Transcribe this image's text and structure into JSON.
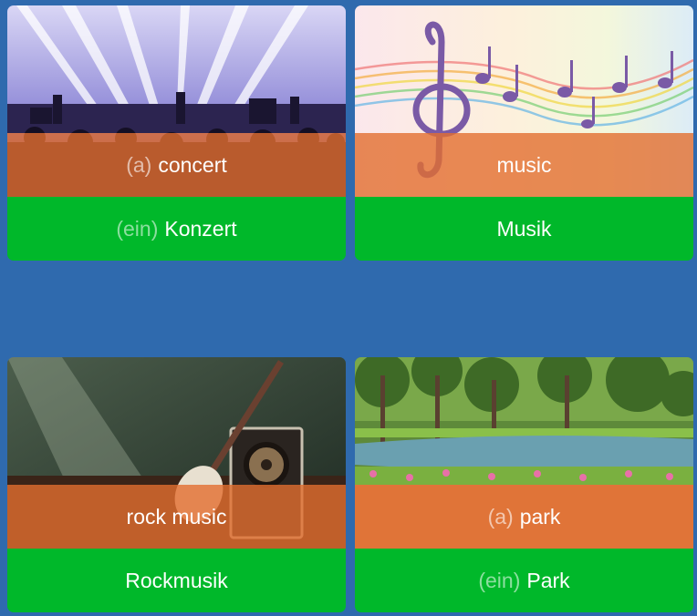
{
  "cards": [
    {
      "image": "concert-stage-photo",
      "english_article": "(a)",
      "english": "concert",
      "german_article": "(ein)",
      "german": "Konzert"
    },
    {
      "image": "music-notes-rainbow-photo",
      "english_article": "",
      "english": "music",
      "german_article": "",
      "german": "Musik"
    },
    {
      "image": "electric-guitar-amp-photo",
      "english_article": "",
      "english": "rock music",
      "german_article": "",
      "german": "Rockmusik"
    },
    {
      "image": "park-lake-tulips-photo",
      "english_article": "(a)",
      "english": "park",
      "german_article": "(ein)",
      "german": "Park"
    }
  ],
  "colors": {
    "background": "#2f6aae",
    "overlay": "#e26e30",
    "answer": "#00b82a",
    "text": "#ffffff"
  }
}
